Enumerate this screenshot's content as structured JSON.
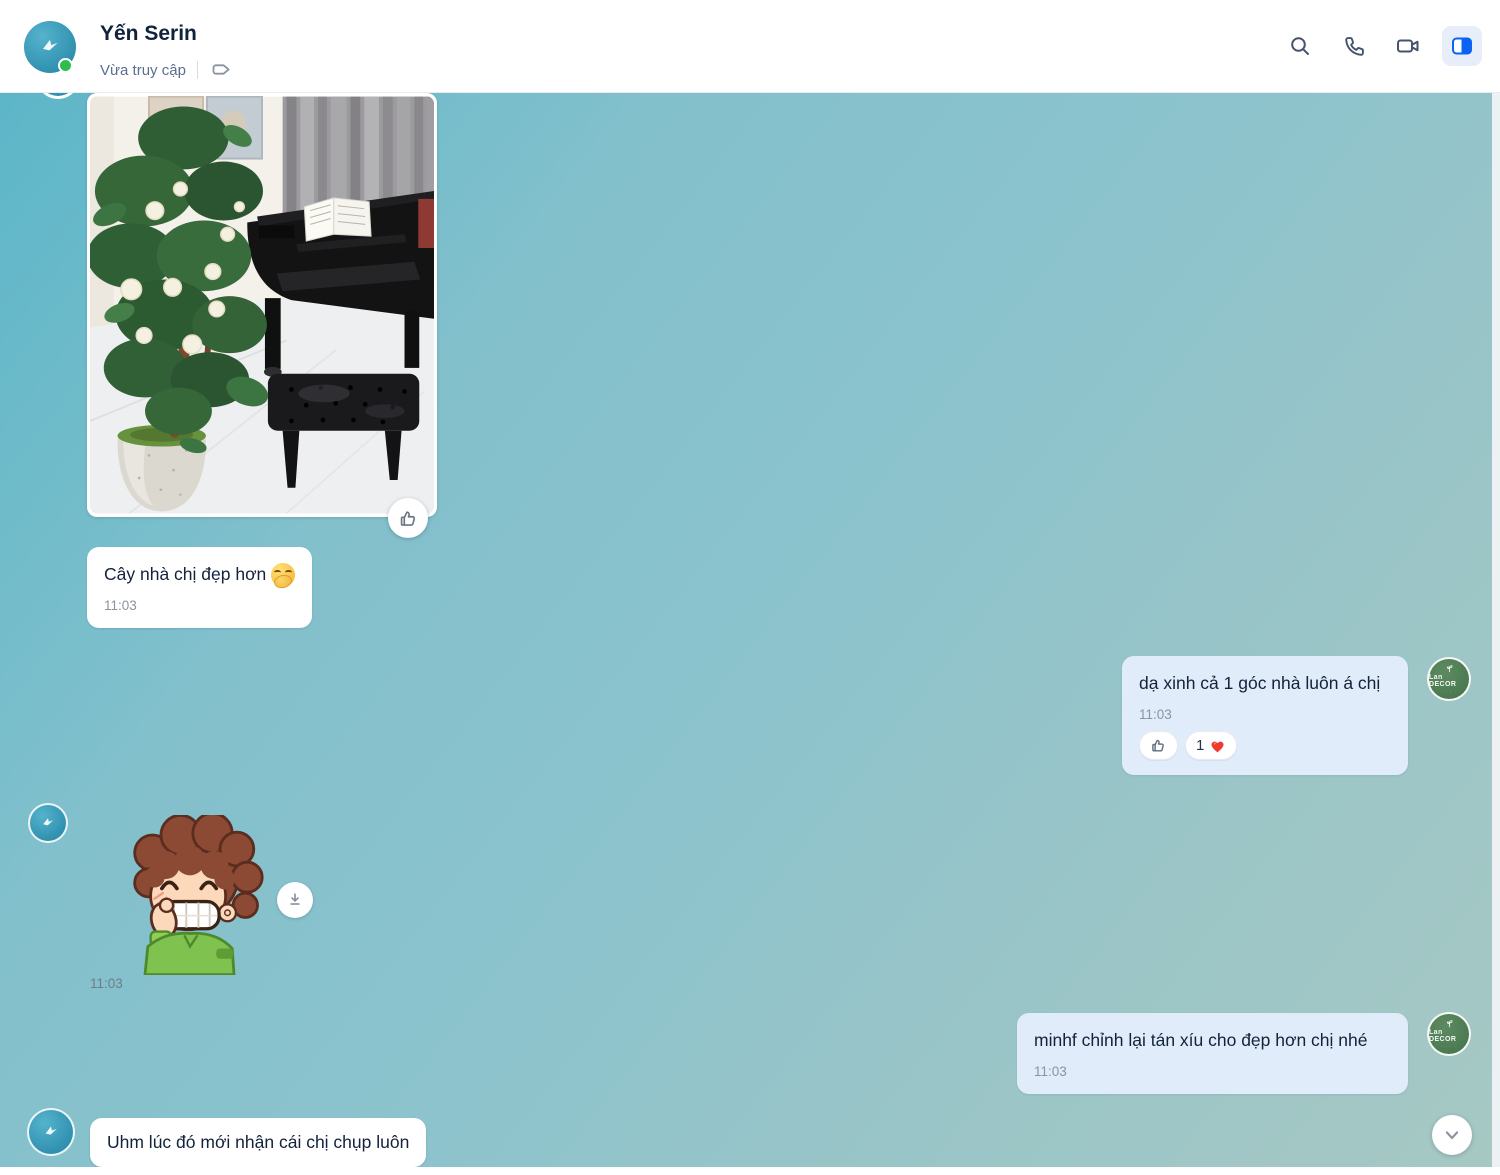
{
  "header": {
    "contact_name": "Yến Serin",
    "status_text": "Vừa truy cập",
    "icons": {
      "tag": "label-tag",
      "search": "search",
      "call": "phone-call",
      "video": "video-call",
      "toggle_panel": "conversation-info-toggle"
    }
  },
  "chat": {
    "photo_message": {
      "description": "Photo: potted tree with white flowers beside black grand piano and tufted bench",
      "like_icon": "thumbs-up"
    },
    "msg_tree": {
      "text": "Cây nhà chị đẹp hơn",
      "emoji": "🤭",
      "time": "11:03"
    },
    "msg_xinh": {
      "text": "dạ xinh cả 1 góc nhà luôn á chị",
      "time": "11:03",
      "reaction_thumb_icon": "thumbs-up",
      "reaction_count": "1",
      "reaction_heart": "❤️"
    },
    "sticker_message": {
      "description": "Sticker: laughing boy covering mouth",
      "time": "11:03",
      "download_icon": "download"
    },
    "msg_chinh": {
      "text": "minhf chỉnh lại tán xíu cho đẹp hơn chị nhé",
      "time": "11:03"
    },
    "msg_uhm": {
      "text": "Uhm lúc đó mới nhận cái chị chụp luôn"
    },
    "right_avatar_brand": "Lan DECOR",
    "scroll_to_bottom_icon": "chevron-down"
  },
  "colors": {
    "accent_blue": "#0b63f3",
    "bubble_right": "#e1ecfa",
    "bubble_left": "#ffffff",
    "chat_bg_top": "#5cb6c8",
    "chat_bg_bottom": "#a6c8c3",
    "online_green": "#2fbd4f",
    "heart_red": "#ee3b2f",
    "avatar_green": "#4a7950"
  }
}
